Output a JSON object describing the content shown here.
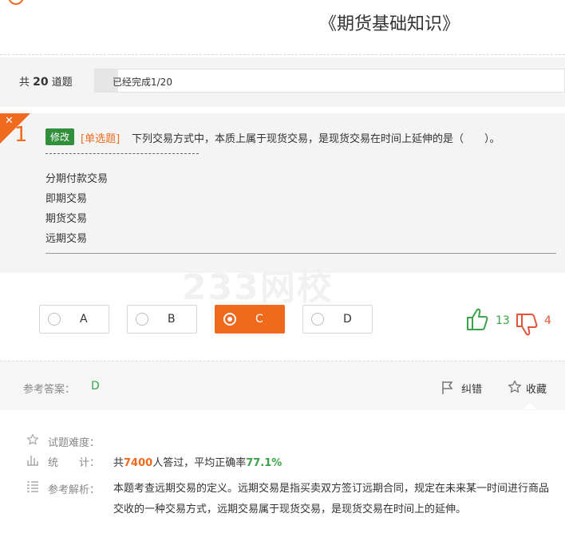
{
  "header": {
    "title": "《期货基础知识》"
  },
  "progress": {
    "total_prefix": "共",
    "total_count": "20",
    "total_suffix": "道题",
    "completed_text": "已经完成1/20",
    "fraction": 0.05
  },
  "question": {
    "number": "1",
    "corner_icon": "close-icon",
    "edit_label": "修改",
    "type_label": "[单选题]",
    "text": "下列交易方式中，本质上属于现货交易，是现货交易在时间上延伸的是（　　）。",
    "options": [
      "分期付款交易",
      "即期交易",
      "期货交易",
      "远期交易"
    ]
  },
  "watermark": "233网校",
  "choices": [
    {
      "label": "A",
      "selected": false
    },
    {
      "label": "B",
      "selected": false
    },
    {
      "label": "C",
      "selected": true
    },
    {
      "label": "D",
      "selected": false
    }
  ],
  "votes": {
    "up_count": "13",
    "down_count": "4",
    "up_color": "#3aa34a",
    "down_color": "#e0553a"
  },
  "answer": {
    "label": "参考答案：",
    "value": "D",
    "report_label": "纠错",
    "favorite_label": "收藏"
  },
  "meta": {
    "difficulty_label": "试题难度：",
    "stats_label": "统　　计：",
    "stats_prefix": "共",
    "stats_count": "7400",
    "stats_middle": "人答过，平均正确率",
    "stats_rate": "77.1%",
    "analysis_label": "参考解析：",
    "analysis_text": "本题考查远期交易的定义。远期交易是指买卖双方签订远期合同，规定在未来某一时间进行商品交收的一种交易方式，远期交易属于现货交易，是现货交易在时间上的延伸。"
  },
  "colors": {
    "accent": "#f06a1e",
    "edit_green": "#2f8f3a",
    "answer_green": "#3aa34a"
  }
}
